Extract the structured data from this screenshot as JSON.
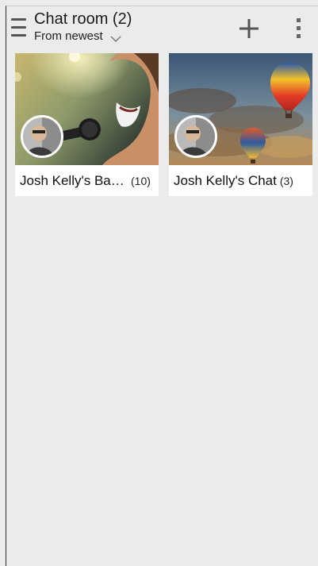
{
  "header": {
    "title": "Chat room (2)",
    "sort_label": "From newest"
  },
  "rooms": [
    {
      "name": "Josh Kelly's Ba…",
      "count": "(10)"
    },
    {
      "name": "Josh Kelly's Chat",
      "count": "(3)"
    }
  ],
  "colors": {
    "background": "#ebebeb",
    "card": "#ffffff",
    "icon_gray": "#555555"
  }
}
